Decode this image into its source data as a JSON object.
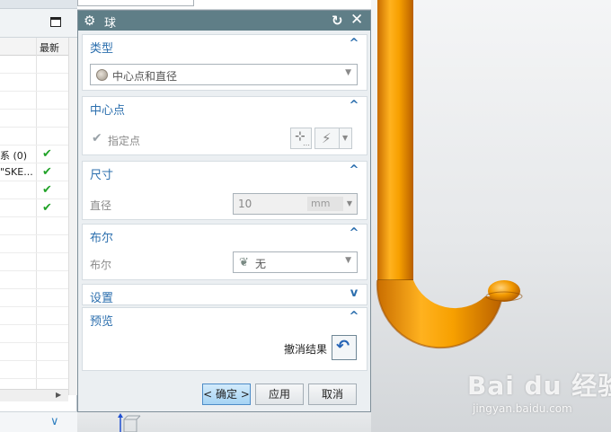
{
  "navigator": {
    "column_latest": "最新",
    "rows": [
      {
        "label": "",
        "checked": false
      },
      {
        "label": "",
        "checked": false
      },
      {
        "label": "",
        "checked": false
      },
      {
        "label": "",
        "checked": false
      },
      {
        "label": "",
        "checked": false
      },
      {
        "label": "系 (0)",
        "checked": true
      },
      {
        "label": "\"SKE...",
        "checked": true
      },
      {
        "label": "",
        "checked": true
      },
      {
        "label": "",
        "checked": true
      },
      {
        "label": "",
        "checked": false
      },
      {
        "label": "",
        "checked": false
      },
      {
        "label": "",
        "checked": false
      },
      {
        "label": "",
        "checked": false
      },
      {
        "label": "",
        "checked": false
      },
      {
        "label": "",
        "checked": false
      },
      {
        "label": "",
        "checked": false
      },
      {
        "label": "",
        "checked": false
      },
      {
        "label": "",
        "checked": false
      }
    ],
    "icons": {
      "maximize": "maximize-icon",
      "check": "check-icon",
      "expand": "chevron-down-icon"
    }
  },
  "dialog": {
    "title": "球",
    "sections": {
      "type": {
        "title": "类型",
        "selected": "中心点和直径",
        "expanded": true
      },
      "center": {
        "title": "中心点",
        "specify_point_label": "指定点",
        "expanded": true
      },
      "size": {
        "title": "尺寸",
        "diameter_label": "直径",
        "diameter_value": "10",
        "unit": "mm",
        "expanded": true
      },
      "boolean": {
        "title": "布尔",
        "boolean_label": "布尔",
        "selected": "无",
        "expanded": true
      },
      "settings": {
        "title": "设置",
        "expanded": false
      },
      "preview": {
        "title": "预览",
        "undo_label": "撤消结果",
        "expanded": true
      }
    },
    "buttons": {
      "ok": "< 确定 >",
      "apply": "应用",
      "cancel": "取消"
    }
  },
  "viewport": {
    "model_color": "#f39a00",
    "watermark_brand": "Bai du 经验",
    "watermark_site": "jingyan.baidu.com"
  },
  "colors": {
    "titlebar": "#5f7e87",
    "section_title": "#2c6fae",
    "ok_button": "#a5d3f4"
  }
}
